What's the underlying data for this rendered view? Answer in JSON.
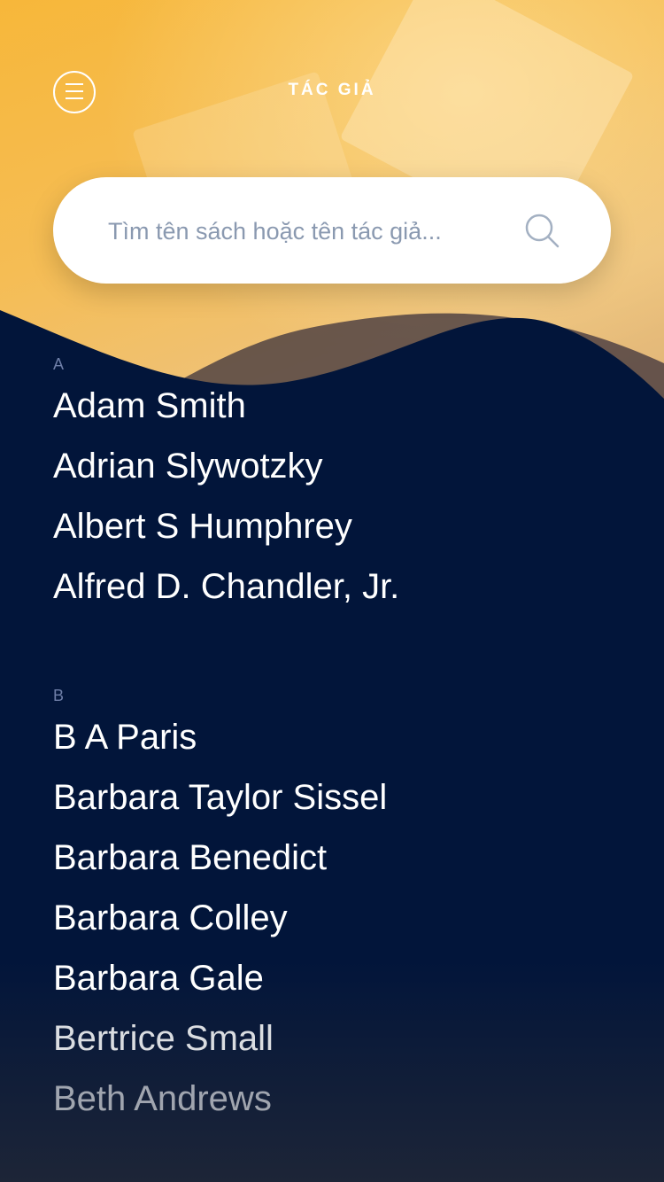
{
  "header": {
    "title": "TÁC GIẢ",
    "menu_icon": "hamburger-menu-icon"
  },
  "search": {
    "placeholder": "Tìm tên sách hoặc tên tác giả...",
    "icon": "search-icon"
  },
  "colors": {
    "background": "#03163b",
    "accent": "#f7b73a",
    "section_letter": "#6f7fa8",
    "text": "#ffffff"
  },
  "sections": [
    {
      "letter": "A",
      "authors": [
        "Adam Smith",
        "Adrian Slywotzky",
        "Albert S Humphrey",
        "Alfred D. Chandler, Jr."
      ]
    },
    {
      "letter": "B",
      "authors": [
        "B A Paris",
        "Barbara Taylor Sissel",
        "Barbara Benedict",
        "Barbara Colley",
        "Barbara Gale",
        "Bertrice Small",
        "Beth Andrews"
      ]
    }
  ]
}
